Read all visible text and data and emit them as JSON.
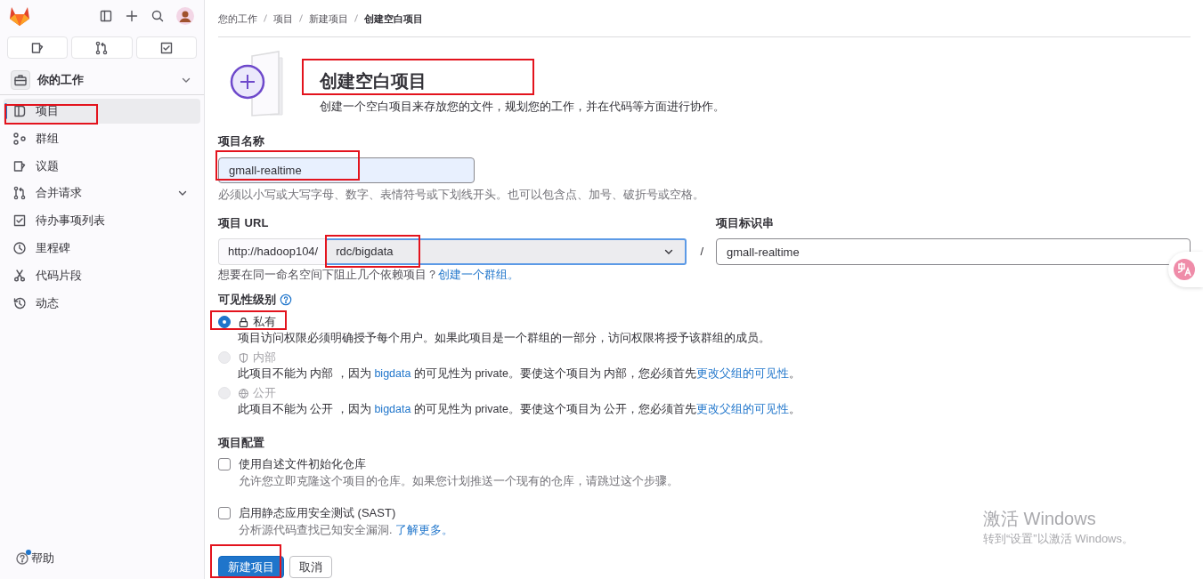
{
  "sidebar": {
    "context": {
      "title": "你的工作"
    },
    "items": [
      {
        "label": "项目",
        "selected": true,
        "has_submenu": false,
        "highlighted": true
      },
      {
        "label": "群组",
        "selected": false,
        "has_submenu": false,
        "highlighted": false
      },
      {
        "label": "议题",
        "selected": false,
        "has_submenu": false,
        "highlighted": false
      },
      {
        "label": "合并请求",
        "selected": false,
        "has_submenu": true,
        "highlighted": false
      },
      {
        "label": "待办事项列表",
        "selected": false,
        "has_submenu": false,
        "highlighted": false
      },
      {
        "label": "里程碑",
        "selected": false,
        "has_submenu": false,
        "highlighted": false
      },
      {
        "label": "代码片段",
        "selected": false,
        "has_submenu": false,
        "highlighted": false
      },
      {
        "label": "动态",
        "selected": false,
        "has_submenu": false,
        "highlighted": false
      }
    ],
    "help": {
      "label": "帮助"
    }
  },
  "breadcrumb": [
    {
      "label": "您的工作",
      "current": false
    },
    {
      "label": "项目",
      "current": false
    },
    {
      "label": "新建项目",
      "current": false
    },
    {
      "label": "创建空白项目",
      "current": true
    }
  ],
  "header": {
    "title": "创建空白项目",
    "title_highlighted": true,
    "description": "创建一个空白项目来存放您的文件，规划您的工作，并在代码等方面进行协作。"
  },
  "name_field": {
    "label": "项目名称",
    "value": "gmall-realtime",
    "highlighted": true,
    "help": "必须以小写或大写字母、数字、表情符号或下划线开头。也可以包含点、加号、破折号或空格。"
  },
  "url": {
    "label": "项目 URL",
    "prefix": "http://hadoop104/",
    "namespace": "rdc/bigdata",
    "namespace_highlighted": true,
    "separator": "/",
    "slug_label": "项目标识串",
    "slug": "gmall-realtime",
    "help": [
      {
        "kind": "text",
        "text": "想要在同一命名空间下阻止几个依赖项目？"
      },
      {
        "kind": "link",
        "text": "创建一个群组。"
      }
    ]
  },
  "visibility": {
    "label": "可见性级别",
    "options": [
      {
        "label": "私有",
        "selected": true,
        "disabled": false,
        "highlighted": true,
        "description": [
          {
            "kind": "text",
            "text": "项目访问权限必须明确授予每个用户。如果此项目是一个群组的一部分，访问权限将授予该群组的成员。"
          }
        ]
      },
      {
        "label": "内部",
        "selected": false,
        "disabled": true,
        "highlighted": false,
        "description": [
          {
            "kind": "text",
            "text": "此项目不能为 内部 ，因为 "
          },
          {
            "kind": "link",
            "text": "bigdata"
          },
          {
            "kind": "text",
            "text": " 的可见性为 private。要使这个项目为 内部，您必须首先"
          },
          {
            "kind": "link",
            "text": "更改父组的可见性"
          },
          {
            "kind": "text",
            "text": "。"
          }
        ]
      },
      {
        "label": "公开",
        "selected": false,
        "disabled": true,
        "highlighted": false,
        "description": [
          {
            "kind": "text",
            "text": "此项目不能为 公开 ，因为 "
          },
          {
            "kind": "link",
            "text": "bigdata"
          },
          {
            "kind": "text",
            "text": " 的可见性为 private。要使这个项目为 公开，您必须首先"
          },
          {
            "kind": "link",
            "text": "更改父组的可见性"
          },
          {
            "kind": "text",
            "text": "。"
          }
        ]
      }
    ]
  },
  "config": {
    "label": "项目配置",
    "options": [
      {
        "label": "使用自述文件初始化仓库",
        "checked": false,
        "description": [
          {
            "kind": "text",
            "text": "允许您立即克隆这个项目的仓库。如果您计划推送一个现有的仓库，请跳过这个步骤。"
          }
        ]
      },
      {
        "label": "启用静态应用安全测试 (SAST)",
        "checked": false,
        "description": [
          {
            "kind": "text",
            "text": "分析源代码查找已知安全漏洞. "
          },
          {
            "kind": "link",
            "text": "了解更多。"
          }
        ]
      }
    ]
  },
  "buttons": [
    {
      "kind": "primary",
      "label": "新建项目",
      "highlighted": true
    },
    {
      "kind": "secondary",
      "label": "取消",
      "highlighted": false
    }
  ],
  "activation_notice": {
    "title": "激活 Windows",
    "subtitle": "转到“设置”以激活 Windows。"
  }
}
